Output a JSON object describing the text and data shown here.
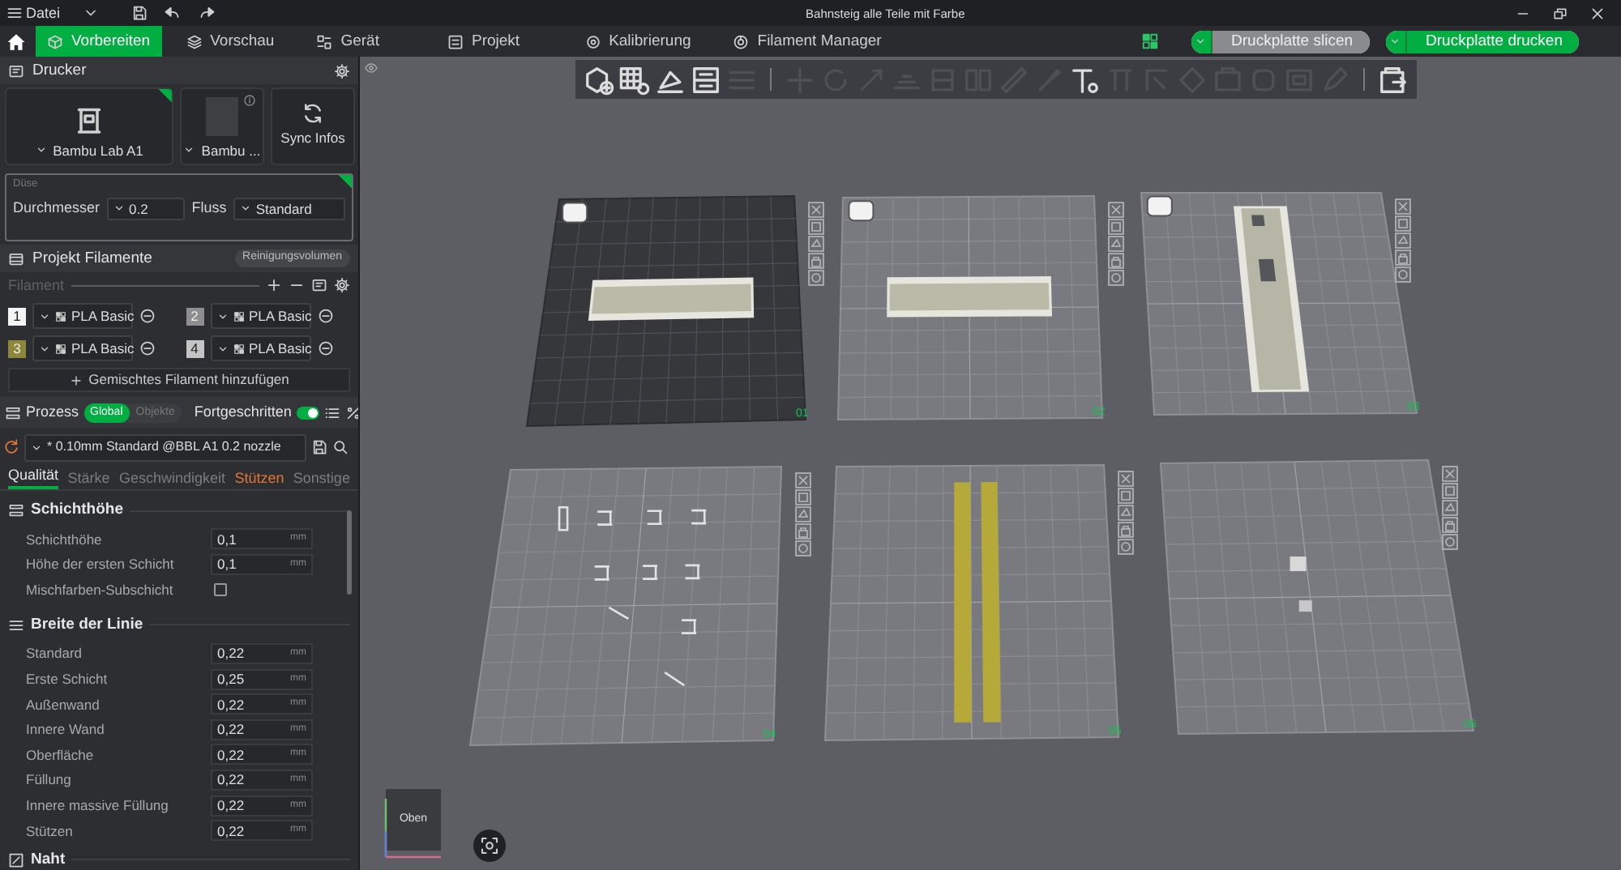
{
  "title_bar": {
    "menu": "Datei",
    "title": "Bahnsteig alle Teile mit Farbe"
  },
  "tabs": [
    {
      "label": "Vorbereiten",
      "kind": "prepare",
      "selected": true
    },
    {
      "label": "Vorschau",
      "kind": "preview",
      "selected": false
    },
    {
      "label": "Gerät",
      "kind": "device",
      "selected": false
    },
    {
      "label": "Projekt",
      "kind": "project",
      "selected": false
    },
    {
      "label": "Kalibrierung",
      "kind": "calibration",
      "selected": false
    },
    {
      "label": "Filament Manager",
      "kind": "filament",
      "selected": false
    }
  ],
  "actions": [
    {
      "label": "Druckplatte slicen",
      "kind": "slice"
    },
    {
      "label": "Druckplatte drucken",
      "kind": "print"
    }
  ],
  "printer": {
    "title": "Drucker",
    "cards": [
      {
        "kind": "printer",
        "label": "Bambu Lab A1"
      },
      {
        "kind": "plate",
        "label": "Bambu ..."
      }
    ],
    "sync": "Sync Infos"
  },
  "nozzle": {
    "title": "Düse",
    "diameter_label": "Durchmesser",
    "diameter": "0.2",
    "flow_label": "Fluss",
    "flow": "Standard"
  },
  "filaments": {
    "title": "Projekt Filamente",
    "purge_button": "Reinigungsvolumen",
    "label": "Filament",
    "slots": [
      {
        "number": "1",
        "color": "#f4f4f4",
        "name": "PLA Basic"
      },
      {
        "number": "2",
        "color": "#8e8e8e",
        "name": "PLA Basic"
      },
      {
        "number": "3",
        "color": "#8c873a",
        "name": "PLA Basic"
      },
      {
        "number": "4",
        "color": "#c4c4c4",
        "name": "PLA Basic"
      }
    ],
    "add_button": "Gemischtes Filament hinzufügen"
  },
  "process": {
    "title": "Prozess",
    "scope": [
      {
        "label": "Global",
        "selected": true
      },
      {
        "label": "Objekte",
        "selected": false
      }
    ],
    "advanced_label": "Fortgeschritten",
    "advanced": true,
    "preset": "* 0.10mm Standard @BBL A1 0.2 nozzle",
    "tabs": [
      {
        "label": "Qualität",
        "selected": true,
        "modified": false
      },
      {
        "label": "Stärke",
        "selected": false,
        "modified": false
      },
      {
        "label": "Geschwindigkeit",
        "selected": false,
        "modified": false
      },
      {
        "label": "Stützen",
        "selected": false,
        "modified": true
      },
      {
        "label": "Sonstige",
        "selected": false,
        "modified": false
      }
    ]
  },
  "settings": [
    {
      "title": "Schichthöhe",
      "kind": "layers",
      "rows": [
        {
          "kind": "number",
          "label": "Schichthöhe",
          "value": "0,1",
          "unit": "mm"
        },
        {
          "kind": "number",
          "label": "Höhe der ersten Schicht",
          "value": "0,1",
          "unit": "mm"
        },
        {
          "kind": "checkbox",
          "label": "Mischfarben-Subschicht",
          "checked": false
        }
      ]
    },
    {
      "title": "Breite der Linie",
      "kind": "lines",
      "rows": [
        {
          "kind": "number",
          "label": "Standard",
          "value": "0,22",
          "unit": "mm"
        },
        {
          "kind": "number",
          "label": "Erste Schicht",
          "value": "0,25",
          "unit": "mm"
        },
        {
          "kind": "number",
          "label": "Außenwand",
          "value": "0,22",
          "unit": "mm"
        },
        {
          "kind": "number",
          "label": "Innere Wand",
          "value": "0,22",
          "unit": "mm"
        },
        {
          "kind": "number",
          "label": "Oberfläche",
          "value": "0,22",
          "unit": "mm"
        },
        {
          "kind": "number",
          "label": "Füllung",
          "value": "0,22",
          "unit": "mm"
        },
        {
          "kind": "number",
          "label": "Innere massive Füllung",
          "value": "0,22",
          "unit": "mm"
        },
        {
          "kind": "number",
          "label": "Stützen",
          "value": "0,22",
          "unit": "mm"
        }
      ]
    },
    {
      "title": "Naht",
      "kind": "seam"
    }
  ],
  "viewport": {
    "tools": [
      {
        "kind": "add-model",
        "disabled": false
      },
      {
        "kind": "add-plate",
        "disabled": false
      },
      {
        "kind": "orient",
        "disabled": false
      },
      {
        "kind": "layout",
        "disabled": false
      },
      {
        "kind": "list",
        "disabled": true
      },
      {
        "kind": "separator"
      },
      {
        "kind": "move",
        "disabled": true
      },
      {
        "kind": "rotate",
        "disabled": true
      },
      {
        "kind": "scale",
        "disabled": true
      },
      {
        "kind": "lift",
        "disabled": true
      },
      {
        "kind": "cut",
        "disabled": true
      },
      {
        "kind": "split",
        "disabled": true
      },
      {
        "kind": "measure",
        "disabled": true
      },
      {
        "kind": "paint",
        "disabled": true
      },
      {
        "kind": "text",
        "disabled": false
      },
      {
        "kind": "support",
        "disabled": true
      },
      {
        "kind": "seam",
        "disabled": true
      },
      {
        "kind": "mesh",
        "disabled": true
      },
      {
        "kind": "assembly",
        "disabled": true
      },
      {
        "kind": "brim",
        "disabled": true
      },
      {
        "kind": "fuzzy",
        "disabled": true
      },
      {
        "kind": "pen",
        "disabled": true
      },
      {
        "kind": "separator"
      },
      {
        "kind": "export",
        "disabled": false
      }
    ],
    "plates": [
      {
        "label": "01",
        "selected": true,
        "plate_icon": true,
        "kind": "rail"
      },
      {
        "label": "02",
        "selected": false,
        "plate_icon": true,
        "kind": "rail"
      },
      {
        "label": "03",
        "selected": false,
        "plate_icon": true,
        "kind": "rail-vertical"
      },
      {
        "label": "04",
        "selected": false,
        "plate_icon": false,
        "kind": "brackets"
      },
      {
        "label": "05",
        "selected": false,
        "plate_icon": false,
        "kind": "strips"
      },
      {
        "label": "06",
        "selected": false,
        "plate_icon": false,
        "kind": "parts"
      }
    ],
    "view_cube": "Oben"
  }
}
